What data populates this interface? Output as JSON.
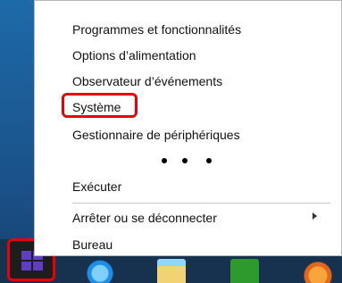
{
  "menu": {
    "items": [
      {
        "label": "Programmes et fonctionnalités"
      },
      {
        "label": "Options d’alimentation"
      },
      {
        "label": "Observateur d’événements"
      },
      {
        "label": "Système"
      },
      {
        "label": "Gestionnaire de périphériques"
      },
      {
        "label": "Exécuter"
      },
      {
        "label": "Arrêter ou se déconnecter",
        "has_submenu": true
      },
      {
        "label": "Bureau"
      }
    ],
    "ellipsis": "• • •"
  },
  "highlights": [
    "Système",
    "start-button"
  ],
  "taskbar": {
    "apps": [
      "internet-explorer-icon",
      "file-explorer-icon",
      "store-icon",
      "firefox-icon"
    ]
  },
  "colors": {
    "highlight": "#e8000b",
    "start_logo": "#5f3ec0",
    "taskbar": "#17324f"
  }
}
